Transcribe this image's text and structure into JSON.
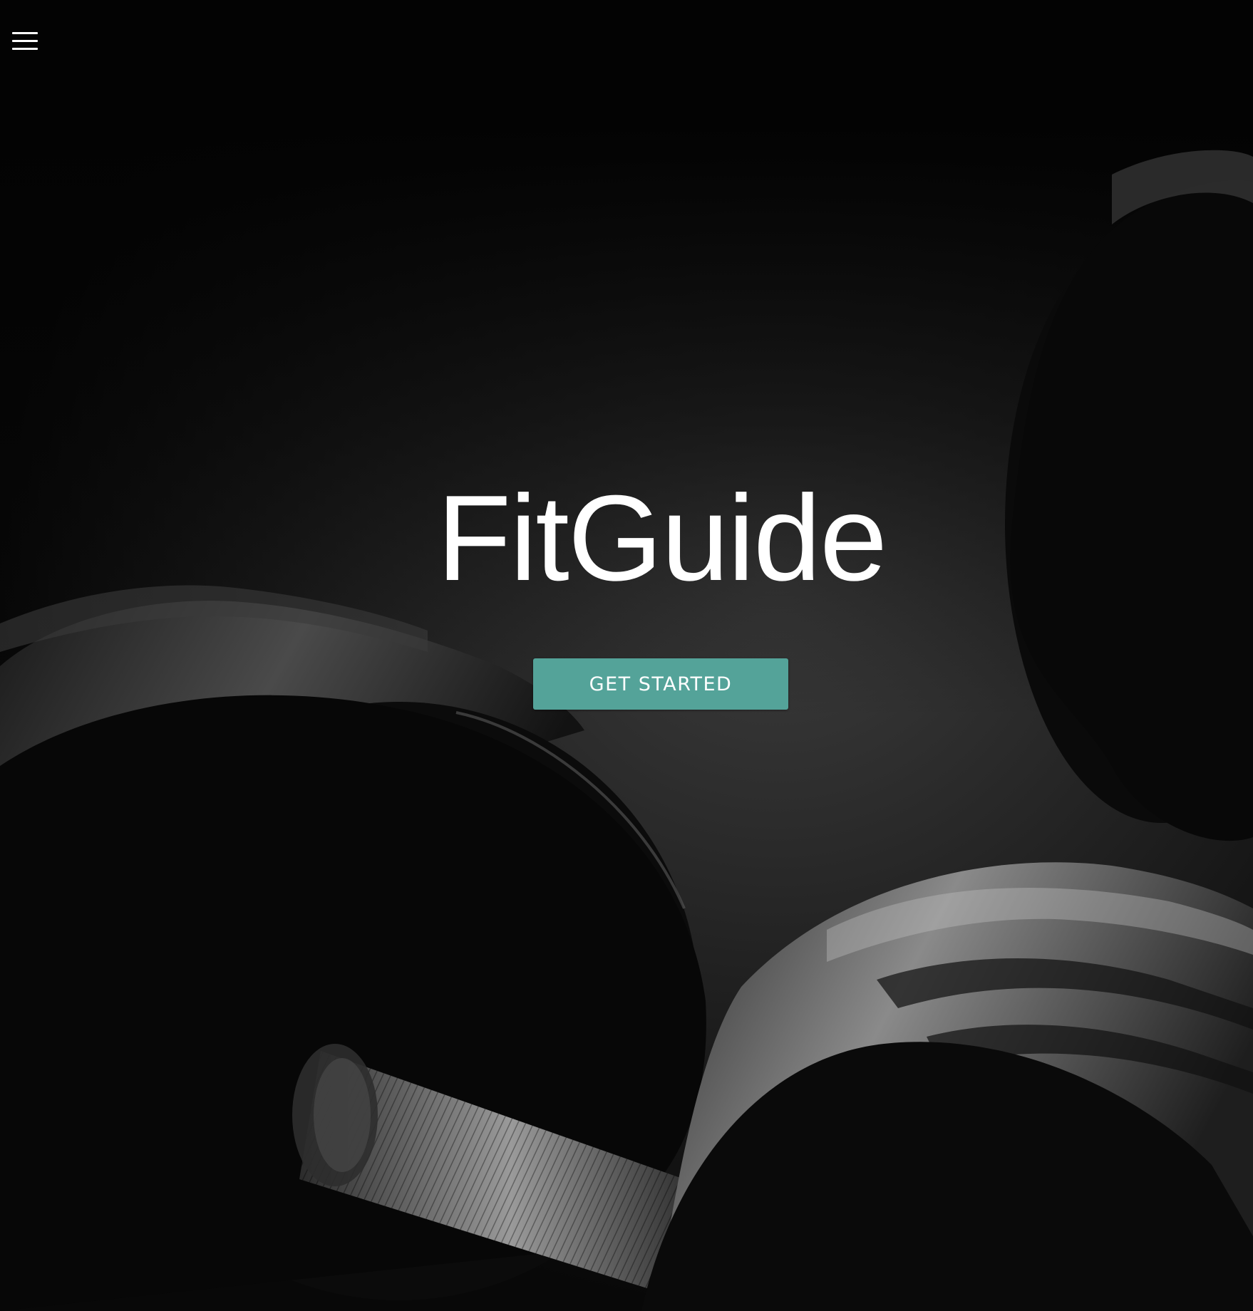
{
  "nav": {
    "menu_icon": "hamburger-menu-icon"
  },
  "hero": {
    "title": "FitGuide",
    "cta_label": "GET STARTED",
    "background": "dark-dumbbell-photo"
  },
  "colors": {
    "accent": "#54a399",
    "background": "#050505",
    "text": "#ffffff"
  }
}
